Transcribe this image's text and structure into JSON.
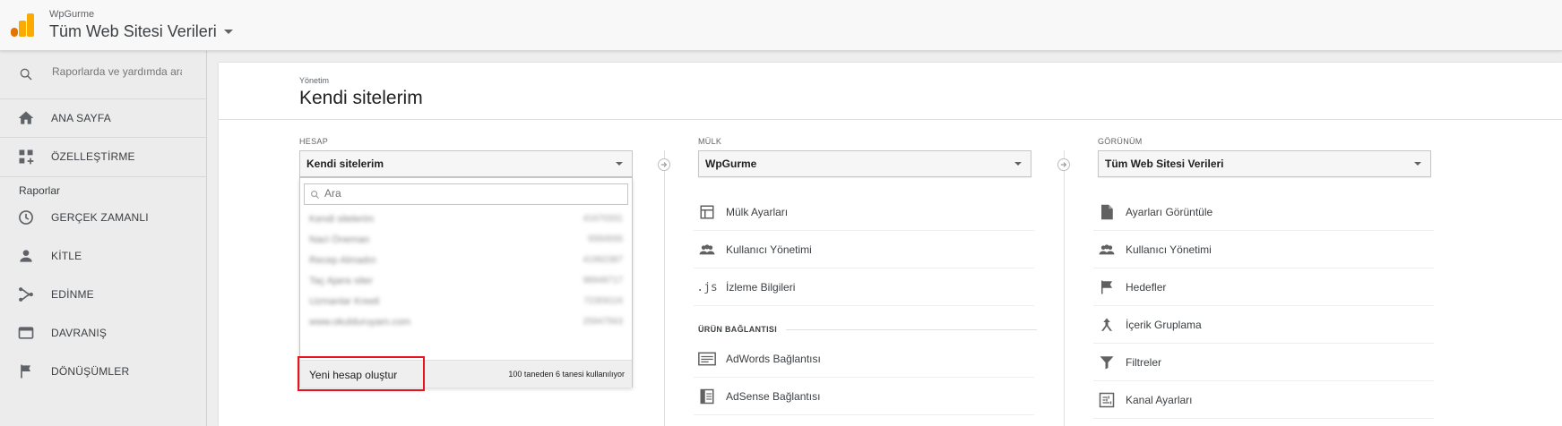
{
  "header": {
    "account_name": "WpGurme",
    "view_name": "Tüm Web Sitesi Verileri"
  },
  "sidebar": {
    "search_placeholder": "Raporlarda ve yardımda ara",
    "items": [
      {
        "label": "ANA SAYFA",
        "icon": "home-icon"
      },
      {
        "label": "ÖZELLEŞTİRME",
        "icon": "dashboard-customize-icon"
      }
    ],
    "reports_label": "Raporlar",
    "report_items": [
      {
        "label": "GERÇEK ZAMANLI",
        "icon": "clock-icon"
      },
      {
        "label": "KİTLE",
        "icon": "person-icon"
      },
      {
        "label": "EDİNME",
        "icon": "acquisition-icon"
      },
      {
        "label": "DAVRANIŞ",
        "icon": "behavior-icon"
      },
      {
        "label": "DÖNÜŞÜMLER",
        "icon": "flag-icon"
      }
    ]
  },
  "main": {
    "breadcrumb": "Yönetim",
    "title": "Kendi sitelerim",
    "columns": {
      "account": {
        "label": "HESAP",
        "selected": "Kendi sitelerim"
      },
      "property": {
        "label": "MÜLK",
        "selected": "WpGurme",
        "items": [
          {
            "label": "Mülk Ayarları",
            "icon": "property-settings-icon"
          },
          {
            "label": "Kullanıcı Yönetimi",
            "icon": "users-icon"
          },
          {
            "label": "İzleme Bilgileri",
            "icon": "js-icon"
          }
        ],
        "section_label": "ÜRÜN BAĞLANTISI",
        "link_items": [
          {
            "label": "AdWords Bağlantısı",
            "icon": "adwords-icon"
          },
          {
            "label": "AdSense Bağlantısı",
            "icon": "adsense-icon"
          }
        ]
      },
      "view": {
        "label": "GÖRÜNÜM",
        "selected": "Tüm Web Sitesi Verileri",
        "items": [
          {
            "label": "Ayarları Görüntüle",
            "icon": "document-icon"
          },
          {
            "label": "Kullanıcı Yönetimi",
            "icon": "users-icon"
          },
          {
            "label": "Hedefler",
            "icon": "flag-icon"
          },
          {
            "label": "İçerik Gruplama",
            "icon": "content-grouping-icon"
          },
          {
            "label": "Filtreler",
            "icon": "filter-icon"
          },
          {
            "label": "Kanal Ayarları",
            "icon": "channel-settings-icon"
          }
        ]
      }
    }
  },
  "account_dropdown": {
    "search_placeholder": "Ara",
    "accounts": [
      {
        "name": "Kendi sitelerim",
        "id": "41670331"
      },
      {
        "name": "Naci Öneman",
        "id": "5550555"
      },
      {
        "name": "Recep Almadın",
        "id": "41992387"
      },
      {
        "name": "Taç Ajans siter",
        "id": "98948717"
      },
      {
        "name": "Uzmanlar Kreeli",
        "id": "72359116"
      },
      {
        "name": "www.okulduruyam.com",
        "id": "25947563"
      }
    ],
    "new_account_label": "Yeni hesap oluştur",
    "usage_text": "100 taneden 6 tanesi kullanılıyor"
  },
  "colors": {
    "highlight": "#e8131e",
    "logo_orange": "#f9ab00",
    "logo_dark_orange": "#e37400"
  }
}
